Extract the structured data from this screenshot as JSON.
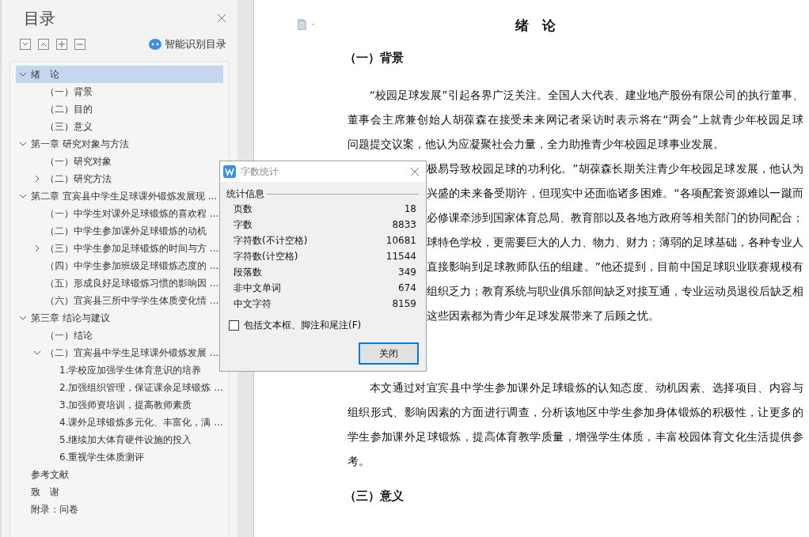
{
  "toc_panel": {
    "title": "目录",
    "smart_button": "智能识别目录",
    "tree": [
      {
        "label": "绪　论",
        "selected": true,
        "expanded": true,
        "children": [
          {
            "label": "（一）背景",
            "selected": false
          },
          {
            "label": "（二）目的",
            "selected": false
          },
          {
            "label": "（三）意义",
            "selected": false
          }
        ]
      },
      {
        "label": "第一章  研究对象与方法",
        "selected": false,
        "expanded": true,
        "children": [
          {
            "label": "（一）研究对象",
            "selected": false
          },
          {
            "label": "（二）研究方法",
            "selected": false,
            "expanded": false
          }
        ]
      },
      {
        "label": "第二章  宜宾县中学生足球课外锻炼发展现 ...",
        "selected": false,
        "expanded": true,
        "children": [
          {
            "label": "（一）中学生对课外足球锻炼的喜欢程 ...",
            "selected": false
          },
          {
            "label": "（二）中学生参加课外足球锻炼的动机",
            "selected": false
          },
          {
            "label": "（三）中学生参加足球锻炼的时间与方 ...",
            "selected": false,
            "expanded": false
          },
          {
            "label": "（四）中学生参加班级足球锻炼态度的 ...",
            "selected": false
          },
          {
            "label": "（五）形成良好足球锻炼习惯的影响因 ...",
            "selected": false
          },
          {
            "label": "（六）宜宾县三所中学学生体质变化情 ...",
            "selected": false
          }
        ]
      },
      {
        "label": "第三章  结论与建议",
        "selected": false,
        "expanded": true,
        "children": [
          {
            "label": "（一）结论",
            "selected": false
          },
          {
            "label": "（二）宜宾县中学生足球课外锻炼发展 ...",
            "selected": false,
            "expanded": true,
            "children": [
              {
                "label": "1.学校应加强学生体育意识的培养",
                "selected": false
              },
              {
                "label": "2.加强组织管理，保证课余足球锻炼 ...",
                "selected": false
              },
              {
                "label": "3.加强师资培训，提高教师素质",
                "selected": false
              },
              {
                "label": "4.课外足球锻炼多元化、丰富化，满 ...",
                "selected": false
              },
              {
                "label": "5.继续加大体育硬件设施的投入",
                "selected": false
              },
              {
                "label": "6.重视学生体质测评",
                "selected": false
              }
            ]
          }
        ]
      },
      {
        "label": "参考文献",
        "selected": false
      },
      {
        "label": "致　谢",
        "selected": false
      },
      {
        "label": "附录：问卷",
        "selected": false
      }
    ]
  },
  "document": {
    "title": "绪　论",
    "blocks": [
      {
        "kind": "heading",
        "text": "（一）背景"
      },
      {
        "kind": "paragraph",
        "lines": [
          {
            "kind": "first",
            "text": "“校园足球发展”引起各界广泛关注。全国人大代表、建业地产股份有限公司的执行董事、"
          },
          {
            "kind": "full",
            "text": "董事会主席兼创始人胡葆森在接受未来网记者采访时表示将在“两会”上就青少年校园足球"
          },
          {
            "kind": "last",
            "text": "问题提交议案，他认为应凝聚社会力量，全力助推青少年校园足球事业发展。"
          },
          {
            "kind": "partial",
            "text": "极易导致校园足球的功利化。”胡葆森长期关注青少年校园足球发展，他认为"
          },
          {
            "kind": "partial",
            "text": "兴盛的未来备受期许，但现实中还面临诸多困难。“各项配套资源难以一蹴而"
          },
          {
            "kind": "partial",
            "text": "必修课牵涉到国家体育总局、教育部以及各地方政府等相关部门的协同配合；"
          },
          {
            "kind": "partial",
            "text": "球特色学校，更需要巨大的人力、物力、财力；薄弱的足球基础，各种专业人"
          },
          {
            "kind": "partial",
            "text": "直接影响到足球教师队伍的组建。”他还提到，目前中国足球职业联赛规模有"
          },
          {
            "kind": "partial",
            "text": "组织乏力；教育系统与职业俱乐部间缺乏对接互通，专业运动员退役后缺乏相"
          },
          {
            "kind": "partial_last",
            "text": "这些因素都为青少年足球发展带来了后顾之忧。"
          }
        ]
      },
      {
        "kind": "hidden_heading"
      },
      {
        "kind": "paragraph",
        "lines": [
          {
            "kind": "first",
            "text": "本文通过对宜宾县中学生参加课外足球锻炼的认知态度、动机因素、选择项目、内容与"
          },
          {
            "kind": "full",
            "text": "组织形式、影响因素的方面进行调查，分析该地区中学生参加身体锻炼的积极性，让更多的"
          },
          {
            "kind": "full",
            "text": "学生参加课外足球锻炼，提高体育教学质量，增强学生体质，丰富校园体育文化生活提供参"
          },
          {
            "kind": "last",
            "text": "考。"
          }
        ]
      },
      {
        "kind": "heading",
        "text": "（三）意义"
      }
    ]
  },
  "dialog": {
    "title": "字数统计",
    "group": "统计信息",
    "stats": [
      {
        "label": "页数",
        "value": "18"
      },
      {
        "label": "字数",
        "value": "8833"
      },
      {
        "label": "字符数(不计空格)",
        "value": "10681"
      },
      {
        "label": "字符数(计空格)",
        "value": "11544"
      },
      {
        "label": "段落数",
        "value": "349"
      },
      {
        "label": "非中文单词",
        "value": "674"
      },
      {
        "label": "中文字符",
        "value": "8159"
      }
    ],
    "checkbox": {
      "label": "包括文本框、脚注和尾注(F)",
      "checked": false
    },
    "button": "关闭"
  }
}
